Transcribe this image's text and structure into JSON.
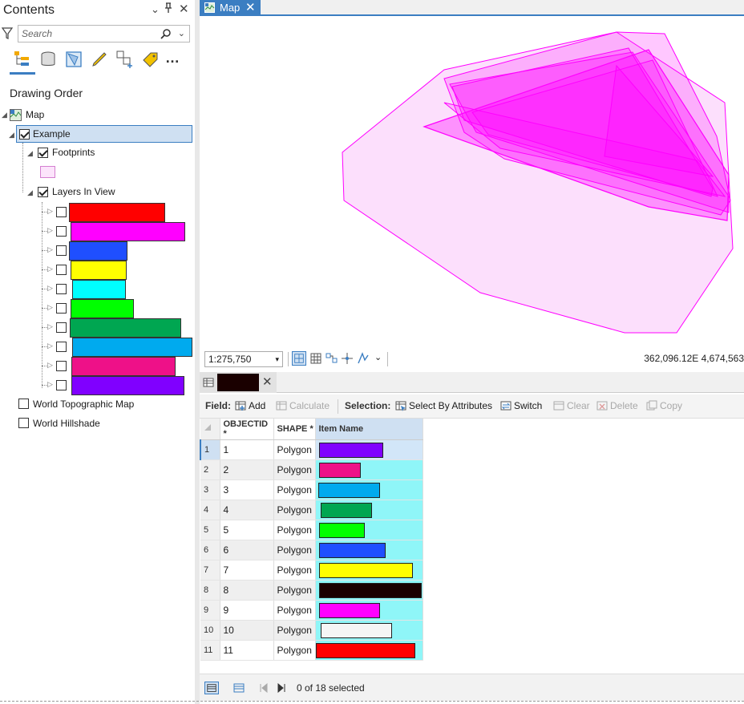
{
  "contents": {
    "title": "Contents",
    "search_placeholder": "Search",
    "drawing_order_label": "Drawing Order",
    "map_label": "Map",
    "group_label": "Example",
    "footprints_label": "Footprints",
    "footprints_swatch": "#fce4fb",
    "layers_in_view_label": "Layers In View",
    "layer_swatches": [
      "#ff0000",
      "#ff00ff",
      "#1f4fff",
      "#ffff00",
      "#00ffff",
      "#00ff00",
      "#00a651",
      "#00aaee",
      "#ee1188",
      "#8000ff"
    ],
    "basemaps": [
      "World Topographic Map",
      "World Hillshade"
    ]
  },
  "map": {
    "tab_label": "Map",
    "scale": "1:275,750",
    "coordinates": "362,096.12E 4,674,563",
    "footprint_fill": "#ff00ff",
    "footprint_light": "#fcd9fb"
  },
  "table": {
    "title_color": "#1a0000",
    "toolbar": {
      "field_label": "Field:",
      "add_label": "Add",
      "calculate_label": "Calculate",
      "selection_label": "Selection:",
      "select_by_attributes_label": "Select By Attributes",
      "switch_label": "Switch",
      "clear_label": "Clear",
      "delete_label": "Delete",
      "copy_label": "Copy"
    },
    "columns": [
      "OBJECTID *",
      "SHAPE *",
      "Item Name"
    ],
    "rows": [
      {
        "row": "1",
        "objectid": "1",
        "shape": "Polygon",
        "color": "#8000ff"
      },
      {
        "row": "2",
        "objectid": "2",
        "shape": "Polygon",
        "color": "#ee1188"
      },
      {
        "row": "3",
        "objectid": "3",
        "shape": "Polygon",
        "color": "#00aaee"
      },
      {
        "row": "4",
        "objectid": "4",
        "shape": "Polygon",
        "color": "#00a651"
      },
      {
        "row": "5",
        "objectid": "5",
        "shape": "Polygon",
        "color": "#00ff00"
      },
      {
        "row": "6",
        "objectid": "6",
        "shape": "Polygon",
        "color": "#1f4fff"
      },
      {
        "row": "7",
        "objectid": "7",
        "shape": "Polygon",
        "color": "#ffff00"
      },
      {
        "row": "8",
        "objectid": "8",
        "shape": "Polygon",
        "color": "#1a0000"
      },
      {
        "row": "9",
        "objectid": "9",
        "shape": "Polygon",
        "color": "#ff00ff"
      },
      {
        "row": "10",
        "objectid": "10",
        "shape": "Polygon",
        "color": "#f5f5f5"
      },
      {
        "row": "11",
        "objectid": "11",
        "shape": "Polygon",
        "color": "#ff0000"
      }
    ],
    "selected_count": "0 of 18 selected"
  }
}
